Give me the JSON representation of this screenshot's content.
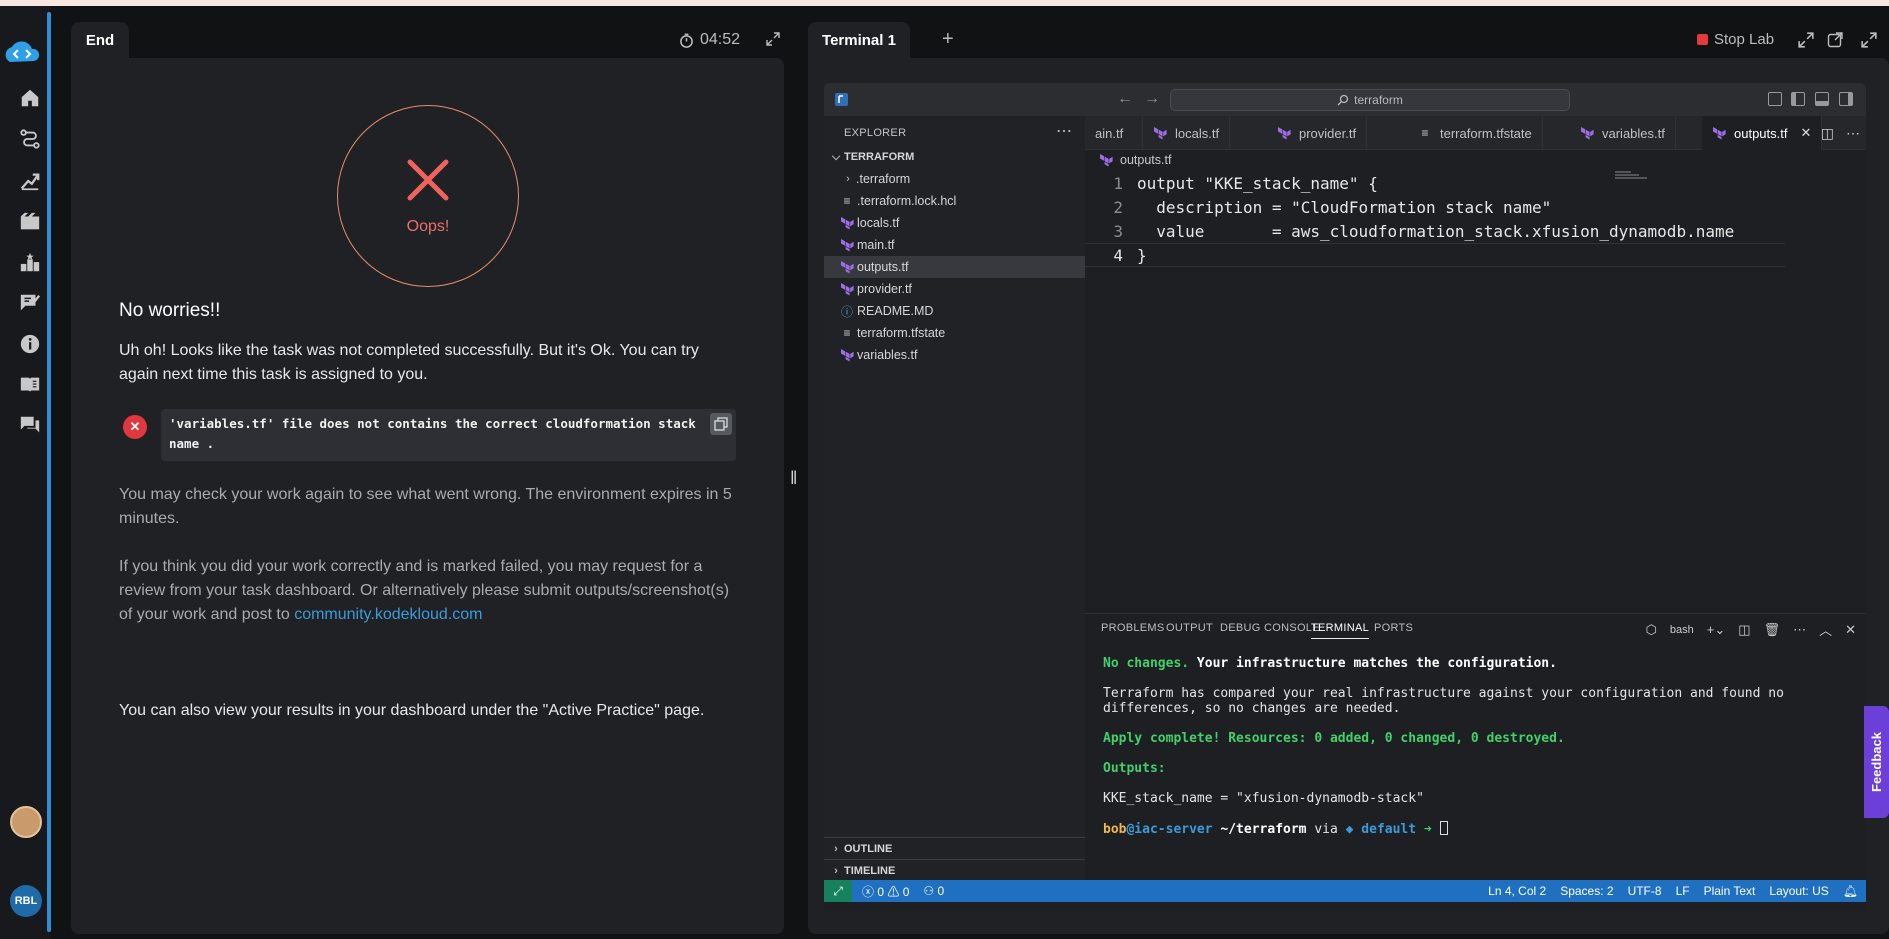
{
  "left_panel": {
    "tab_label": "End",
    "timer": "04:52",
    "oops": "Oops!",
    "heading": "No worries!!",
    "intro": "Uh oh! Looks like the task was not completed successfully. But it's Ok. You can try again next time this task is assigned to you.",
    "error_message": "'variables.tf' file does not contains the correct cloudformation stack name .",
    "check_text": "You may check your work again to see what went wrong. The environment expires in 5 minutes.",
    "review_text": "If you think you did your work correctly and is marked failed, you may request for a review from your task dashboard. Or alternatively please submit outputs/screenshot(s) of your work and post to ",
    "review_link": "community.kodekloud.com",
    "dashboard_text": "You can also view your results in your dashboard under the \"Active Practice\" page."
  },
  "rail": {
    "icons": [
      "home-icon",
      "roadmap-icon",
      "progress-icon",
      "video-icon",
      "leaderboard-icon",
      "notes-icon",
      "info-icon",
      "book-icon",
      "chat-icon"
    ],
    "user_initials": "RBL"
  },
  "right_panel": {
    "tab_label": "Terminal 1",
    "add_tab": "+",
    "stop_lab": "Stop Lab"
  },
  "vscode": {
    "search": "terraform",
    "explorer_title": "EXPLORER",
    "folder": "TERRAFORM",
    "files": [
      {
        "name": ".terraform",
        "kind": "folder"
      },
      {
        "name": ".terraform.lock.hcl",
        "kind": "lines"
      },
      {
        "name": "locals.tf",
        "kind": "tf"
      },
      {
        "name": "main.tf",
        "kind": "tf"
      },
      {
        "name": "outputs.tf",
        "kind": "tf",
        "selected": true
      },
      {
        "name": "provider.tf",
        "kind": "tf"
      },
      {
        "name": "README.MD",
        "kind": "info"
      },
      {
        "name": "terraform.tfstate",
        "kind": "lines"
      },
      {
        "name": "variables.tf",
        "kind": "tf"
      }
    ],
    "outline": "OUTLINE",
    "timeline": "TIMELINE",
    "tabs": [
      {
        "label": "ain.tf",
        "icon": "tf"
      },
      {
        "label": "locals.tf",
        "icon": "tf"
      },
      {
        "label": "provider.tf",
        "icon": "tf"
      },
      {
        "label": "terraform.tfstate",
        "icon": "lines"
      },
      {
        "label": "variables.tf",
        "icon": "tf"
      },
      {
        "label": "outputs.tf",
        "icon": "tf",
        "active": true
      }
    ],
    "breadcrumb": "outputs.tf",
    "code_lines": [
      "output \"KKE_stack_name\" {",
      "  description = \"CloudFormation stack name\"",
      "  value       = aws_cloudformation_stack.xfusion_dynamodb.name",
      "}"
    ],
    "panel_tabs": [
      "PROBLEMS",
      "OUTPUT",
      "DEBUG CONSOLE",
      "TERMINAL",
      "PORTS"
    ],
    "panel_active": "TERMINAL",
    "shell": "bash",
    "terminal": {
      "no_changes_green": "No changes.",
      "no_changes_rest": " Your infrastructure matches the configuration.",
      "compared_1": "Terraform has compared your real infrastructure against your configuration and found no",
      "compared_2": "differences, so no changes are needed.",
      "apply": "Apply complete! Resources: 0 added, 0 changed, 0 destroyed.",
      "outputs": "Outputs:",
      "output_value": "KKE_stack_name = \"xfusion-dynamodb-stack\"",
      "prompt_user": "bob",
      "prompt_host": "@iac-server",
      "prompt_path": " ~/terraform",
      "prompt_via": " via ",
      "prompt_env": "◆ default",
      "prompt_arrow": " ➜ "
    },
    "status": {
      "errors": "0",
      "warnings": "0",
      "ports": "0",
      "position": "Ln 4, Col 2",
      "spaces": "Spaces: 2",
      "encoding": "UTF-8",
      "eol": "LF",
      "language": "Plain Text",
      "layout": "Layout: US"
    }
  },
  "feedback": "Feedback"
}
